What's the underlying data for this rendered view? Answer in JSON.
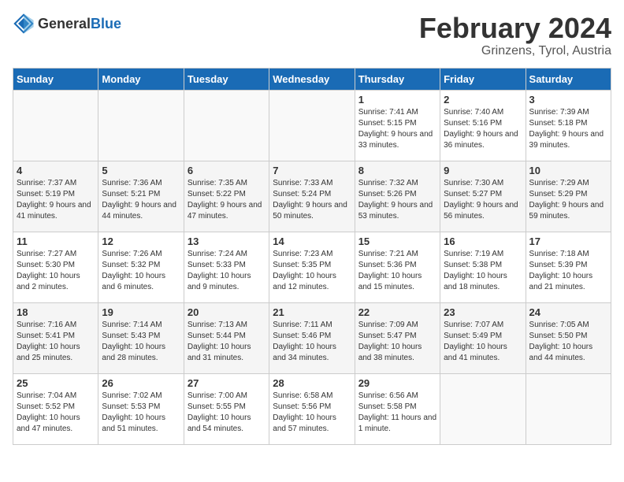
{
  "header": {
    "logo_general": "General",
    "logo_blue": "Blue",
    "title": "February 2024",
    "subtitle": "Grinzens, Tyrol, Austria"
  },
  "days_of_week": [
    "Sunday",
    "Monday",
    "Tuesday",
    "Wednesday",
    "Thursday",
    "Friday",
    "Saturday"
  ],
  "weeks": [
    [
      {
        "day": "",
        "sunrise": "",
        "sunset": "",
        "daylight": ""
      },
      {
        "day": "",
        "sunrise": "",
        "sunset": "",
        "daylight": ""
      },
      {
        "day": "",
        "sunrise": "",
        "sunset": "",
        "daylight": ""
      },
      {
        "day": "",
        "sunrise": "",
        "sunset": "",
        "daylight": ""
      },
      {
        "day": "1",
        "sunrise": "Sunrise: 7:41 AM",
        "sunset": "Sunset: 5:15 PM",
        "daylight": "Daylight: 9 hours and 33 minutes."
      },
      {
        "day": "2",
        "sunrise": "Sunrise: 7:40 AM",
        "sunset": "Sunset: 5:16 PM",
        "daylight": "Daylight: 9 hours and 36 minutes."
      },
      {
        "day": "3",
        "sunrise": "Sunrise: 7:39 AM",
        "sunset": "Sunset: 5:18 PM",
        "daylight": "Daylight: 9 hours and 39 minutes."
      }
    ],
    [
      {
        "day": "4",
        "sunrise": "Sunrise: 7:37 AM",
        "sunset": "Sunset: 5:19 PM",
        "daylight": "Daylight: 9 hours and 41 minutes."
      },
      {
        "day": "5",
        "sunrise": "Sunrise: 7:36 AM",
        "sunset": "Sunset: 5:21 PM",
        "daylight": "Daylight: 9 hours and 44 minutes."
      },
      {
        "day": "6",
        "sunrise": "Sunrise: 7:35 AM",
        "sunset": "Sunset: 5:22 PM",
        "daylight": "Daylight: 9 hours and 47 minutes."
      },
      {
        "day": "7",
        "sunrise": "Sunrise: 7:33 AM",
        "sunset": "Sunset: 5:24 PM",
        "daylight": "Daylight: 9 hours and 50 minutes."
      },
      {
        "day": "8",
        "sunrise": "Sunrise: 7:32 AM",
        "sunset": "Sunset: 5:26 PM",
        "daylight": "Daylight: 9 hours and 53 minutes."
      },
      {
        "day": "9",
        "sunrise": "Sunrise: 7:30 AM",
        "sunset": "Sunset: 5:27 PM",
        "daylight": "Daylight: 9 hours and 56 minutes."
      },
      {
        "day": "10",
        "sunrise": "Sunrise: 7:29 AM",
        "sunset": "Sunset: 5:29 PM",
        "daylight": "Daylight: 9 hours and 59 minutes."
      }
    ],
    [
      {
        "day": "11",
        "sunrise": "Sunrise: 7:27 AM",
        "sunset": "Sunset: 5:30 PM",
        "daylight": "Daylight: 10 hours and 2 minutes."
      },
      {
        "day": "12",
        "sunrise": "Sunrise: 7:26 AM",
        "sunset": "Sunset: 5:32 PM",
        "daylight": "Daylight: 10 hours and 6 minutes."
      },
      {
        "day": "13",
        "sunrise": "Sunrise: 7:24 AM",
        "sunset": "Sunset: 5:33 PM",
        "daylight": "Daylight: 10 hours and 9 minutes."
      },
      {
        "day": "14",
        "sunrise": "Sunrise: 7:23 AM",
        "sunset": "Sunset: 5:35 PM",
        "daylight": "Daylight: 10 hours and 12 minutes."
      },
      {
        "day": "15",
        "sunrise": "Sunrise: 7:21 AM",
        "sunset": "Sunset: 5:36 PM",
        "daylight": "Daylight: 10 hours and 15 minutes."
      },
      {
        "day": "16",
        "sunrise": "Sunrise: 7:19 AM",
        "sunset": "Sunset: 5:38 PM",
        "daylight": "Daylight: 10 hours and 18 minutes."
      },
      {
        "day": "17",
        "sunrise": "Sunrise: 7:18 AM",
        "sunset": "Sunset: 5:39 PM",
        "daylight": "Daylight: 10 hours and 21 minutes."
      }
    ],
    [
      {
        "day": "18",
        "sunrise": "Sunrise: 7:16 AM",
        "sunset": "Sunset: 5:41 PM",
        "daylight": "Daylight: 10 hours and 25 minutes."
      },
      {
        "day": "19",
        "sunrise": "Sunrise: 7:14 AM",
        "sunset": "Sunset: 5:43 PM",
        "daylight": "Daylight: 10 hours and 28 minutes."
      },
      {
        "day": "20",
        "sunrise": "Sunrise: 7:13 AM",
        "sunset": "Sunset: 5:44 PM",
        "daylight": "Daylight: 10 hours and 31 minutes."
      },
      {
        "day": "21",
        "sunrise": "Sunrise: 7:11 AM",
        "sunset": "Sunset: 5:46 PM",
        "daylight": "Daylight: 10 hours and 34 minutes."
      },
      {
        "day": "22",
        "sunrise": "Sunrise: 7:09 AM",
        "sunset": "Sunset: 5:47 PM",
        "daylight": "Daylight: 10 hours and 38 minutes."
      },
      {
        "day": "23",
        "sunrise": "Sunrise: 7:07 AM",
        "sunset": "Sunset: 5:49 PM",
        "daylight": "Daylight: 10 hours and 41 minutes."
      },
      {
        "day": "24",
        "sunrise": "Sunrise: 7:05 AM",
        "sunset": "Sunset: 5:50 PM",
        "daylight": "Daylight: 10 hours and 44 minutes."
      }
    ],
    [
      {
        "day": "25",
        "sunrise": "Sunrise: 7:04 AM",
        "sunset": "Sunset: 5:52 PM",
        "daylight": "Daylight: 10 hours and 47 minutes."
      },
      {
        "day": "26",
        "sunrise": "Sunrise: 7:02 AM",
        "sunset": "Sunset: 5:53 PM",
        "daylight": "Daylight: 10 hours and 51 minutes."
      },
      {
        "day": "27",
        "sunrise": "Sunrise: 7:00 AM",
        "sunset": "Sunset: 5:55 PM",
        "daylight": "Daylight: 10 hours and 54 minutes."
      },
      {
        "day": "28",
        "sunrise": "Sunrise: 6:58 AM",
        "sunset": "Sunset: 5:56 PM",
        "daylight": "Daylight: 10 hours and 57 minutes."
      },
      {
        "day": "29",
        "sunrise": "Sunrise: 6:56 AM",
        "sunset": "Sunset: 5:58 PM",
        "daylight": "Daylight: 11 hours and 1 minute."
      },
      {
        "day": "",
        "sunrise": "",
        "sunset": "",
        "daylight": ""
      },
      {
        "day": "",
        "sunrise": "",
        "sunset": "",
        "daylight": ""
      }
    ]
  ]
}
